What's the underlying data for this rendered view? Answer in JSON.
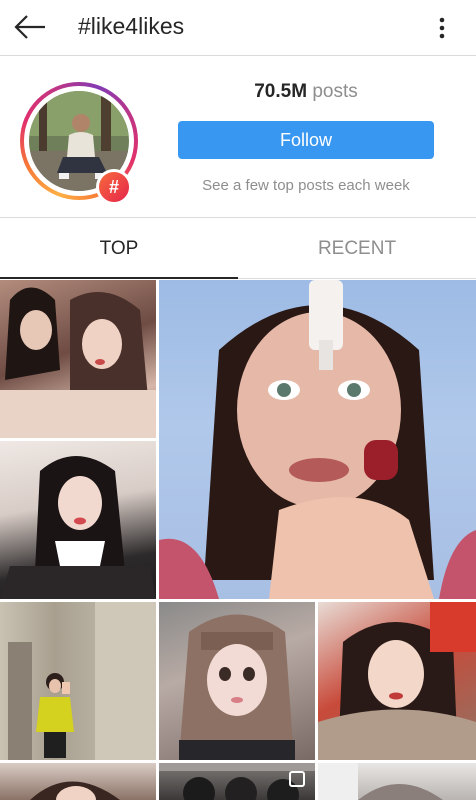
{
  "app_bar": {
    "title": "#like4likes",
    "back_icon": "arrow-left-icon",
    "more_icon": "more-vertical-icon"
  },
  "hashtag_header": {
    "post_count": "70.5M",
    "post_unit": "posts",
    "follow_label": "Follow",
    "subtitle": "See a few top posts each week",
    "badge_symbol": "#",
    "ring_colors": [
      "#fcaf45",
      "#f77737",
      "#e1306c",
      "#c13584",
      "#833ab4"
    ],
    "follow_color": "#3897f0"
  },
  "tabs": [
    {
      "label": "TOP",
      "selected": true
    },
    {
      "label": "RECENT",
      "selected": false
    }
  ],
  "grid": {
    "posts": [
      {
        "kind": "photo",
        "subject": "two-women-selfie"
      },
      {
        "kind": "photo",
        "subject": "girl-selfie-school-uniform"
      },
      {
        "kind": "video",
        "subject": "woman-eye-drops"
      },
      {
        "kind": "photo",
        "subject": "girl-yellow-sweater-hallway"
      },
      {
        "kind": "photo",
        "subject": "girl-with-bangs"
      },
      {
        "kind": "photo",
        "subject": "girl-fur-collar"
      },
      {
        "kind": "photo",
        "subject": "partial-portrait"
      },
      {
        "kind": "carousel",
        "subject": "group-photo"
      },
      {
        "kind": "photo",
        "subject": "partial-portrait"
      }
    ]
  }
}
